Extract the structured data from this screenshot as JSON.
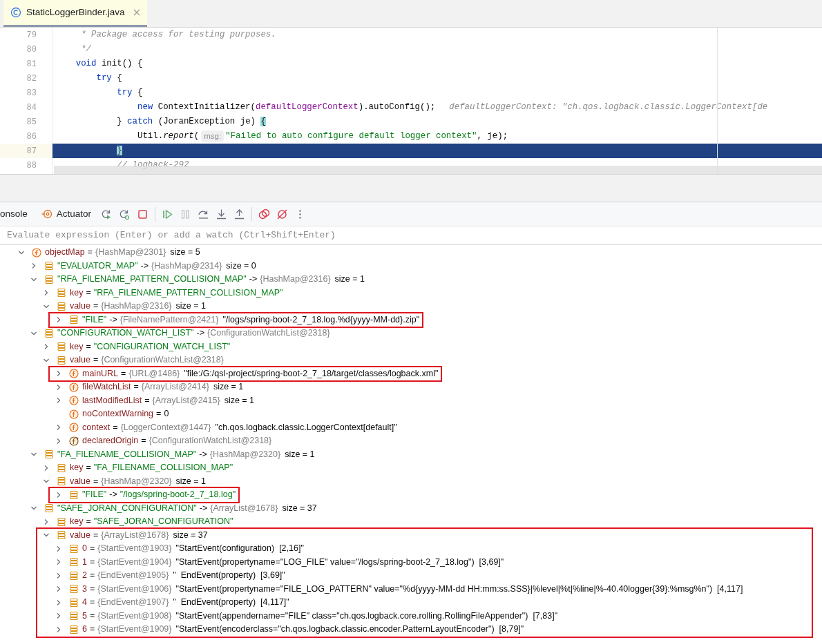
{
  "editor_tabs": [
    {
      "label": "StaticLoggerBinder.java",
      "selected": true
    }
  ],
  "code_lines": [
    {
      "number": "79",
      "current": false,
      "segments": [
        {
          "kind": "comment",
          "text": "     * Package access for testing purposes."
        }
      ]
    },
    {
      "number": "80",
      "current": false,
      "segments": [
        {
          "kind": "comment",
          "text": "     */"
        }
      ]
    },
    {
      "number": "81",
      "current": false,
      "segments": [
        {
          "kind": "keyword",
          "text": "    void "
        },
        {
          "kind": "plain",
          "text": "init() {"
        }
      ]
    },
    {
      "number": "82",
      "current": false,
      "segments": [
        {
          "kind": "keyword",
          "text": "        try "
        },
        {
          "kind": "plain",
          "text": "{"
        }
      ]
    },
    {
      "number": "83",
      "current": false,
      "segments": [
        {
          "kind": "keyword",
          "text": "            try "
        },
        {
          "kind": "plain",
          "text": "{"
        }
      ]
    },
    {
      "number": "84",
      "current": false,
      "segments": [
        {
          "kind": "keyword",
          "text": "                new "
        },
        {
          "kind": "plain",
          "text": "ContextInitializer("
        },
        {
          "kind": "field",
          "text": "defaultLoggerContext"
        },
        {
          "kind": "plain",
          "text": ").autoConfig();"
        },
        {
          "kind": "inlay",
          "text": "defaultLoggerContext: \"ch.qos.logback.classic.LoggerContext[de"
        }
      ]
    },
    {
      "number": "85",
      "current": false,
      "segments": [
        {
          "kind": "plain",
          "text": "            } "
        },
        {
          "kind": "keyword",
          "text": "catch "
        },
        {
          "kind": "plain",
          "text": "(JoranException je) "
        },
        {
          "kind": "brace-match",
          "text": "{"
        }
      ]
    },
    {
      "number": "86",
      "current": false,
      "segments": [
        {
          "kind": "plain",
          "text": "                Util."
        },
        {
          "kind": "static-call",
          "text": "report"
        },
        {
          "kind": "plain",
          "text": "("
        },
        {
          "kind": "hint",
          "text": "msg:"
        },
        {
          "kind": "string",
          "text": "\"Failed to auto configure default logger context\""
        },
        {
          "kind": "plain",
          "text": ", je);"
        }
      ]
    },
    {
      "number": "87",
      "current": true,
      "segments": [
        {
          "kind": "brace-match",
          "text": "            }"
        }
      ]
    },
    {
      "number": "88",
      "current": false,
      "segments": [
        {
          "kind": "comment",
          "text": "            // logback-292"
        }
      ]
    }
  ],
  "debug_tabs": [
    {
      "label": "onsole",
      "selected": false
    },
    {
      "label": "Actuator",
      "selected": false
    }
  ],
  "evaluate": {
    "placeholder": "Evaluate expression (Enter) or add a watch (Ctrl+Shift+Enter)"
  },
  "variables": [
    {
      "kind": "field",
      "expanded": true,
      "highlighted": false,
      "name": "objectMap",
      "separator": "=",
      "type": "{HashMap@2301}",
      "value": "size = 5",
      "children": [
        {
          "kind": "entry",
          "expanded": false,
          "highlighted": false,
          "name": "\"EVALUATOR_MAP\"",
          "separator": "->",
          "type": "{HashMap@2314}",
          "value": "size = 0"
        },
        {
          "kind": "entry",
          "expanded": true,
          "highlighted": false,
          "name": "\"RFA_FILENAME_PATTERN_COLLISION_MAP\"",
          "separator": "->",
          "type": "{HashMap@2316}",
          "value": "size = 1",
          "children": [
            {
              "kind": "entry",
              "expanded": false,
              "highlighted": false,
              "name": "key",
              "separator": "=",
              "value": "\"RFA_FILENAME_PATTERN_COLLISION_MAP\""
            },
            {
              "kind": "entry",
              "expanded": true,
              "highlighted": false,
              "name": "value",
              "separator": "=",
              "type": "{HashMap@2316}",
              "value": "size = 1",
              "children": [
                {
                  "kind": "entry",
                  "expanded": false,
                  "highlighted": true,
                  "name": "\"FILE\"",
                  "separator": "->",
                  "type": "{FileNamePattern@2421}",
                  "value": "\"/logs/spring-boot-2_7_18.log.%d{yyyy-MM-dd}.zip\""
                }
              ]
            }
          ]
        },
        {
          "kind": "entry",
          "expanded": true,
          "highlighted": false,
          "name": "\"CONFIGURATION_WATCH_LIST\"",
          "separator": "->",
          "type": "{ConfigurationWatchList@2318}",
          "children": [
            {
              "kind": "entry",
              "expanded": false,
              "highlighted": false,
              "name": "key",
              "separator": "=",
              "value": "\"CONFIGURATION_WATCH_LIST\""
            },
            {
              "kind": "entry",
              "expanded": true,
              "highlighted": false,
              "name": "value",
              "separator": "=",
              "type": "{ConfigurationWatchList@2318}",
              "children": [
                {
                  "kind": "field",
                  "expanded": false,
                  "highlighted": true,
                  "name": "mainURL",
                  "separator": "=",
                  "type": "{URL@1486}",
                  "value": "\"file:/G:/qsl-project/spring-boot-2_7_18/target/classes/logback.xml\""
                },
                {
                  "kind": "field",
                  "expanded": false,
                  "highlighted": false,
                  "name": "fileWatchList",
                  "separator": "=",
                  "type": "{ArrayList@2414}",
                  "value": "size = 1"
                },
                {
                  "kind": "field",
                  "expanded": false,
                  "highlighted": false,
                  "name": "lastModifiedList",
                  "separator": "=",
                  "type": "{ArrayList@2415}",
                  "value": "size = 1"
                },
                {
                  "kind": "field",
                  "highlighted": false,
                  "name": "noContextWarning",
                  "separator": "=",
                  "value": "0"
                },
                {
                  "kind": "field",
                  "expanded": false,
                  "highlighted": false,
                  "name": "context",
                  "separator": "=",
                  "type": "{LoggerContext@1447}",
                  "value": "\"ch.qos.logback.classic.LoggerContext[default]\""
                },
                {
                  "kind": "inherited-field",
                  "expanded": false,
                  "highlighted": false,
                  "name": "declaredOrigin",
                  "separator": "=",
                  "type": "{ConfigurationWatchList@2318}"
                }
              ]
            }
          ]
        },
        {
          "kind": "entry",
          "expanded": true,
          "highlighted": false,
          "name": "\"FA_FILENAME_COLLISION_MAP\"",
          "separator": "->",
          "type": "{HashMap@2320}",
          "value": "size = 1",
          "children": [
            {
              "kind": "entry",
              "expanded": false,
              "highlighted": false,
              "name": "key",
              "separator": "=",
              "value": "\"FA_FILENAME_COLLISION_MAP\""
            },
            {
              "kind": "entry",
              "expanded": true,
              "highlighted": false,
              "name": "value",
              "separator": "=",
              "type": "{HashMap@2320}",
              "value": "size = 1",
              "children": [
                {
                  "kind": "entry",
                  "expanded": false,
                  "highlighted": true,
                  "name": "\"FILE\"",
                  "separator": "->",
                  "value": "\"/logs/spring-boot-2_7_18.log\""
                }
              ]
            }
          ]
        },
        {
          "kind": "entry",
          "expanded": true,
          "highlighted": false,
          "name": "\"SAFE_JORAN_CONFIGURATION\"",
          "separator": "->",
          "type": "{ArrayList@1678}",
          "value": "size = 37",
          "children": [
            {
              "kind": "entry",
              "expanded": false,
              "highlighted": false,
              "name": "key",
              "separator": "=",
              "value": "\"SAFE_JORAN_CONFIGURATION\""
            },
            {
              "kind": "entry",
              "expanded": true,
              "highlighted": true,
              "name": "value",
              "separator": "=",
              "type": "{ArrayList@1678}",
              "value": "size = 37",
              "children": [
                {
                  "kind": "entry",
                  "expanded": false,
                  "highlighted": false,
                  "name": "0",
                  "separator": "=",
                  "type": "{StartEvent@1903}",
                  "value": "\"StartEvent(configuration)  [2,16]\""
                },
                {
                  "kind": "entry",
                  "expanded": false,
                  "highlighted": false,
                  "name": "1",
                  "separator": "=",
                  "type": "{StartEvent@1904}",
                  "value": "\"StartEvent(propertyname=\"LOG_FILE\" value=\"/logs/spring-boot-2_7_18.log\")  [3,69]\""
                },
                {
                  "kind": "entry",
                  "expanded": false,
                  "highlighted": false,
                  "name": "2",
                  "separator": "=",
                  "type": "{EndEvent@1905}",
                  "value": "\"  EndEvent(property)  [3,69]\""
                },
                {
                  "kind": "entry",
                  "expanded": false,
                  "highlighted": false,
                  "name": "3",
                  "separator": "=",
                  "type": "{StartEvent@1906}",
                  "value": "\"StartEvent(propertyname=\"FILE_LOG_PATTERN\" value=\"%d{yyyy-MM-dd HH:mm:ss.SSS}|%level|%t|%line|%-40.40logger{39}:%msg%n\")  [4,117]"
                },
                {
                  "kind": "entry",
                  "expanded": false,
                  "highlighted": false,
                  "name": "4",
                  "separator": "=",
                  "type": "{EndEvent@1907}",
                  "value": "\"  EndEvent(property)  [4,117]\""
                },
                {
                  "kind": "entry",
                  "expanded": false,
                  "highlighted": false,
                  "name": "5",
                  "separator": "=",
                  "type": "{StartEvent@1908}",
                  "value": "\"StartEvent(appendername=\"FILE\" class=\"ch.qos.logback.core.rolling.RollingFileAppender\")  [7,83]\""
                },
                {
                  "kind": "entry",
                  "expanded": false,
                  "highlighted": false,
                  "name": "6",
                  "separator": "=",
                  "type": "{StartEvent@1909}",
                  "value": "\"StartEvent(encoderclass=\"ch.qos.logback.classic.encoder.PatternLayoutEncoder\")  [8,79]\""
                }
              ]
            }
          ]
        }
      ]
    }
  ]
}
